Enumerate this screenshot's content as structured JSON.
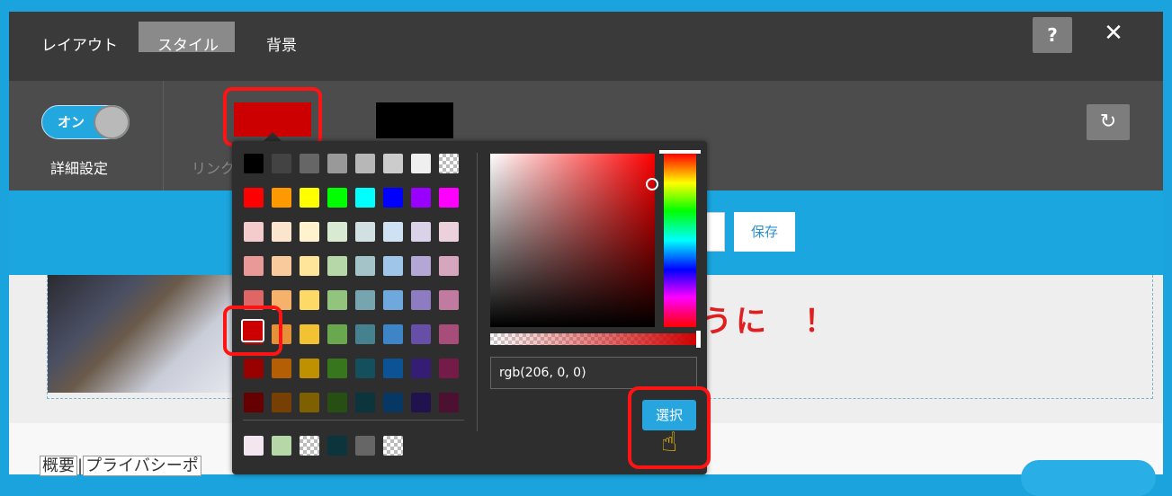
{
  "tabs": [
    {
      "label": "レイアウト"
    },
    {
      "label": "スタイル",
      "active": true
    },
    {
      "label": "背景"
    }
  ],
  "header": {
    "help_label": "?",
    "close_label": "✕"
  },
  "toggle": {
    "label": "オン",
    "state": "on"
  },
  "detail_label": "詳細設定",
  "link_label": "リンク",
  "reset_icon": "↻",
  "save_label": "保存",
  "preview_heading": "うに　！",
  "footer_links": {
    "first": "概要",
    "sep": "|",
    "second": "プライバシーポ"
  },
  "current_swatches": {
    "primary": "#cc0000",
    "secondary": "#000000"
  },
  "palette": [
    [
      "#000000",
      "#434343",
      "#666666",
      "#999999",
      "#b7b7b7",
      "#cccccc",
      "#efefef",
      "checker"
    ],
    [
      "#ff0000",
      "#ff9900",
      "#ffff00",
      "#00ff00",
      "#00ffff",
      "#0000ff",
      "#9900ff",
      "#ff00ff"
    ],
    [
      "#f4cccc",
      "#fce5cd",
      "#fff2cc",
      "#d9ead3",
      "#d0e0e3",
      "#cfe2f3",
      "#d9d2e9",
      "#ead1dc"
    ],
    [
      "#ea9999",
      "#f9cb9c",
      "#ffe599",
      "#b6d7a8",
      "#a2c4c9",
      "#9fc5e8",
      "#b4a7d6",
      "#d5a6bd"
    ],
    [
      "#e06666",
      "#f6b26b",
      "#ffd966",
      "#93c47d",
      "#76a5af",
      "#6fa8dc",
      "#8e7cc3",
      "#c27ba0"
    ],
    [
      "#cc0000",
      "#e69138",
      "#f1c232",
      "#6aa84f",
      "#45818e",
      "#3d85c6",
      "#674ea7",
      "#a64d79"
    ],
    [
      "#990000",
      "#b45f06",
      "#bf9000",
      "#38761d",
      "#134f5c",
      "#0b5394",
      "#351c75",
      "#741b47"
    ],
    [
      "#660000",
      "#783f04",
      "#7f6000",
      "#274e13",
      "#0c343d",
      "#073763",
      "#20124d",
      "#4c1130"
    ]
  ],
  "recent_colors": [
    "#f4e6f0",
    "#b6d7a8",
    "checker",
    "#0c343d",
    "#666666",
    "checker"
  ],
  "color_value": "rgb(206, 0, 0)",
  "select_label": "選択"
}
